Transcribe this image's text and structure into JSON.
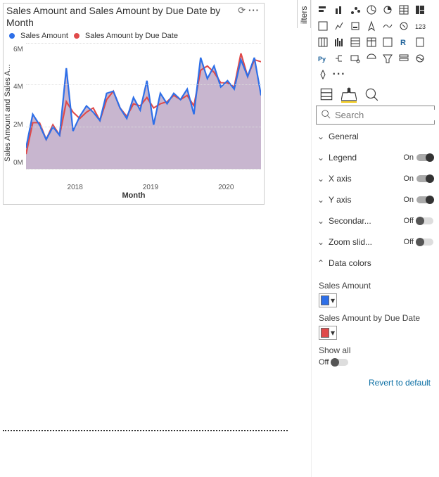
{
  "chart_data": {
    "type": "line",
    "title": "Sales Amount and Sales Amount by Due Date by Month",
    "xlabel": "Month",
    "ylabel": "Sales Amount and Sales A...",
    "x": [
      "2017-07",
      "2017-08",
      "2017-09",
      "2017-10",
      "2017-11",
      "2017-12",
      "2018-01",
      "2018-02",
      "2018-03",
      "2018-04",
      "2018-05",
      "2018-06",
      "2018-07",
      "2018-08",
      "2018-09",
      "2018-10",
      "2018-11",
      "2018-12",
      "2019-01",
      "2019-02",
      "2019-03",
      "2019-04",
      "2019-05",
      "2019-06",
      "2019-07",
      "2019-08",
      "2019-09",
      "2019-10",
      "2019-11",
      "2019-12",
      "2020-01",
      "2020-02",
      "2020-03",
      "2020-04",
      "2020-05",
      "2020-06"
    ],
    "x_ticks": [
      "2018",
      "2019",
      "2020"
    ],
    "y_ticks": [
      "0M",
      "2M",
      "4M",
      "6M"
    ],
    "ylim": [
      0,
      6000000
    ],
    "series": [
      {
        "name": "Sales Amount",
        "color": "#2E6FE8",
        "values": [
          1000000,
          2600000,
          2100000,
          1400000,
          2000000,
          1600000,
          4800000,
          1800000,
          2500000,
          3000000,
          2700000,
          2300000,
          3600000,
          3700000,
          2900000,
          2400000,
          3400000,
          2800000,
          4200000,
          2100000,
          3600000,
          3100000,
          3600000,
          3300000,
          3800000,
          2600000,
          5300000,
          4300000,
          4900000,
          3900000,
          4200000,
          3800000,
          5200000,
          4400000,
          5300000,
          3500000
        ]
      },
      {
        "name": "Sales Amount by Due Date",
        "color": "#E04A4A",
        "values": [
          700000,
          2200000,
          2200000,
          1400000,
          2100000,
          1600000,
          3200000,
          2700000,
          2400000,
          2700000,
          2900000,
          2300000,
          3300000,
          3700000,
          2900000,
          2500000,
          3100000,
          3000000,
          3400000,
          2900000,
          3100000,
          3200000,
          3500000,
          3300000,
          3500000,
          3000000,
          4700000,
          4900000,
          4600000,
          4100000,
          4100000,
          3900000,
          5500000,
          4400000,
          5200000,
          5100000
        ]
      }
    ],
    "legend": [
      "Sales Amount",
      "Sales Amount by Due Date"
    ]
  },
  "viz_header_icons": [
    "filter-icon",
    "focus-mode-icon",
    "drill-icon",
    "more-icon"
  ],
  "filters_tab": "ilters",
  "gallery": [
    "stacked-bar",
    "stacked-column",
    "clustered-bar",
    "line",
    "area",
    "pie",
    "treemap",
    "card",
    "kpi",
    "slicer",
    "arcgis-maps",
    "ribbon",
    "key-influencers",
    "smart-narrative",
    "matrix",
    "scatter",
    "waterfall",
    "table",
    "donut",
    "r-visual",
    "paginated",
    "python",
    "decomposition",
    "qa",
    "gauge",
    "funnel",
    "multi-row",
    "map-shape",
    "get-more"
  ],
  "gallery_more": "···",
  "format_tabs": {
    "fields": "fields-icon",
    "format": "format-icon",
    "analytics": "analytics-icon"
  },
  "search": {
    "placeholder": "Search"
  },
  "sections": {
    "general": {
      "label": "General"
    },
    "legend": {
      "label": "Legend",
      "toggle": "On"
    },
    "xaxis": {
      "label": "X axis",
      "toggle": "On"
    },
    "yaxis": {
      "label": "Y axis",
      "toggle": "On"
    },
    "secondary": {
      "label": "Secondar...",
      "toggle": "Off"
    },
    "zoom": {
      "label": "Zoom slid...",
      "toggle": "Off"
    },
    "datacolors": {
      "label": "Data colors"
    }
  },
  "data_colors": {
    "field1": {
      "label": "Sales Amount",
      "color": "#2E6FE8"
    },
    "field2": {
      "label": "Sales Amount by Due Date",
      "color": "#E04A4A"
    },
    "showall": {
      "label": "Show all",
      "toggle": "Off"
    }
  },
  "revert": "Revert to default"
}
